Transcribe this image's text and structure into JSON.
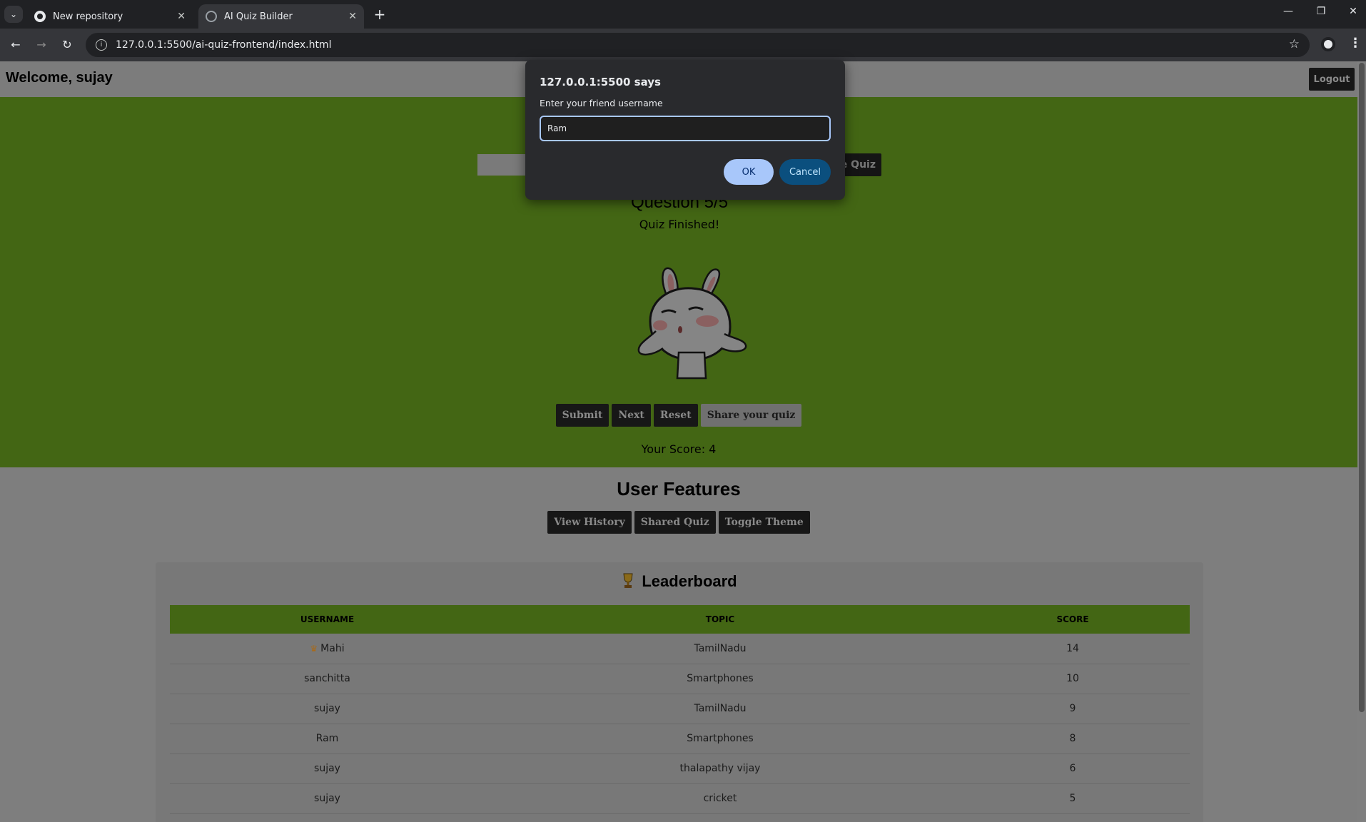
{
  "browser": {
    "tabs": [
      {
        "title": "New repository",
        "close": "✕"
      },
      {
        "title": "AI Quiz Builder",
        "close": "✕"
      }
    ],
    "new_tab": "+",
    "url": "127.0.0.1:5500/ai-quiz-frontend/index.html",
    "window_controls": {
      "minimize": "—",
      "restore": "❐",
      "close": "✕"
    }
  },
  "header": {
    "welcome": "Welcome, sujay",
    "logout_label": "Logout"
  },
  "quiz": {
    "generate_label": "te Quiz",
    "question_title": "Question 5/5",
    "status": "Quiz Finished!",
    "actions": [
      "Submit",
      "Next",
      "Reset",
      "Share your quiz"
    ],
    "score_text": "Your Score: 4"
  },
  "user_features": {
    "title": "User Features",
    "buttons": [
      "View History",
      "Shared Quiz",
      "Toggle Theme"
    ]
  },
  "leaderboard": {
    "title": "Leaderboard",
    "columns": [
      "USERNAME",
      "TOPIC",
      "SCORE"
    ],
    "rows": [
      {
        "username": "Mahi",
        "topic": "TamilNadu",
        "score": "14",
        "crown": true
      },
      {
        "username": "sanchitta",
        "topic": "Smartphones",
        "score": "10"
      },
      {
        "username": "sujay",
        "topic": "TamilNadu",
        "score": "9"
      },
      {
        "username": "Ram",
        "topic": "Smartphones",
        "score": "8"
      },
      {
        "username": "sujay",
        "topic": "thalapathy vijay",
        "score": "6"
      },
      {
        "username": "sujay",
        "topic": "cricket",
        "score": "5"
      }
    ]
  },
  "dialog": {
    "origin": "127.0.0.1:5500 says",
    "message": "Enter your friend username",
    "input_value": "Ram",
    "ok_label": "OK",
    "cancel_label": "Cancel"
  },
  "colors": {
    "hero_green": "#436614",
    "overlay_gray": "#7e7e7e",
    "dialog_bg": "#292a2d",
    "ok_button": "#a8c7fa",
    "cancel_button": "#0b4f7e"
  }
}
